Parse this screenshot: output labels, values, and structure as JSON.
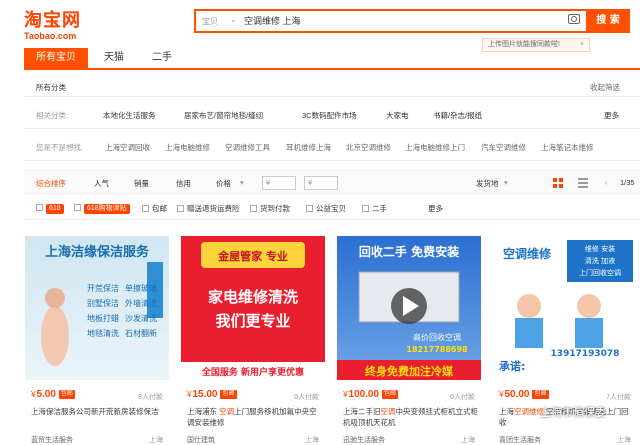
{
  "header": {
    "logo_cn": "淘宝网",
    "logo_en": "Taobao.com",
    "search_type": "宝贝",
    "search_value": "空调维修 上海",
    "search_button": "搜 索",
    "tip": "上传图片就能搜同款啦!"
  },
  "tabs": [
    "所有宝贝",
    "天猫",
    "二手"
  ],
  "breadcrumb": {
    "label": "所有分类",
    "collapse": "收起筛选"
  },
  "category": {
    "label": "相关分类:",
    "items": [
      "本地化生活服务",
      "居家布艺/窗帘地毯/缝纫",
      "3C数码配件市场",
      "大家电",
      "书籍/杂志/报纸"
    ],
    "more": "更多"
  },
  "related": {
    "label": "您是不是想找:",
    "items": [
      "上海空调回收",
      "上海电脑维修",
      "空调维修工具",
      "耳机维修上海",
      "北京空调维修",
      "上海电脑维修上门",
      "汽车空调维修",
      "上海笔记本维修"
    ]
  },
  "filter": {
    "items": [
      "综合排序",
      "人气",
      "销量",
      "信用",
      "价格"
    ],
    "price_from": "¥",
    "price_to": "¥",
    "ship": "发货地",
    "pager": "1/35"
  },
  "checks": {
    "badge1": "618",
    "badge2": "618购物津贴",
    "items": [
      "包邮",
      "赠送退货运费险",
      "货到付款",
      "公益宝贝",
      "二手"
    ],
    "more": "更多"
  },
  "products": [
    {
      "img_text": "上海洁缘保洁服务",
      "price": "5.00",
      "buyers": "8人付款",
      "title_pre": "上海保洁服务公司新开荒新房装修保洁",
      "title_hl": "",
      "title_post": "",
      "shop": "蓝贸生活服务",
      "loc": "上海"
    },
    {
      "img_text": "家电维修清洗",
      "price": "15.00",
      "buyers": "0人付款",
      "title_pre": "上海浦东 ",
      "title_hl": "空调",
      "title_post": "上门服务移机加氟中央空调安装维修",
      "shop": "国仕建筑",
      "loc": "上海"
    },
    {
      "img_text": "回收二手 免费安装",
      "price": "100.00",
      "buyers": "0人付款",
      "title_pre": "上海二手旧",
      "title_hl": "空调",
      "title_post": "中央变频挂式柜机立式柜机吸顶机天花机",
      "shop": "迅驰生活服务",
      "loc": "上海"
    },
    {
      "img_text": "空调维修",
      "price": "50.00",
      "buyers": "7人付款",
      "title_pre": "上海",
      "title_hl": "空调维修",
      "title_post": " 空调移机加氟清洗上门回收",
      "shop": "喜团生活服务",
      "loc": "上海"
    }
  ],
  "img_extra": {
    "p1_lines": [
      "开荒保洁",
      "单擦玻璃",
      "别墅保洁",
      "外墙清洗",
      "地板打蜡",
      "沙发清洗",
      "地毯清洗",
      "石材翻新"
    ],
    "p2_top": "金屋管家 专业",
    "p2_sub": "我们更专业",
    "p2_bottom": "全国服务 新用户享更优惠",
    "p3_phone": "18217788698",
    "p3_bottom": "终身免费加注冷媒",
    "p3_text": "高价回收空调",
    "p4_phone": "13917193078",
    "p4_promise": "承诺:",
    "p4_labels": [
      "维修 安装",
      "清洗 加液",
      "上门回收空调"
    ]
  },
  "watermark": "上海市消保委"
}
